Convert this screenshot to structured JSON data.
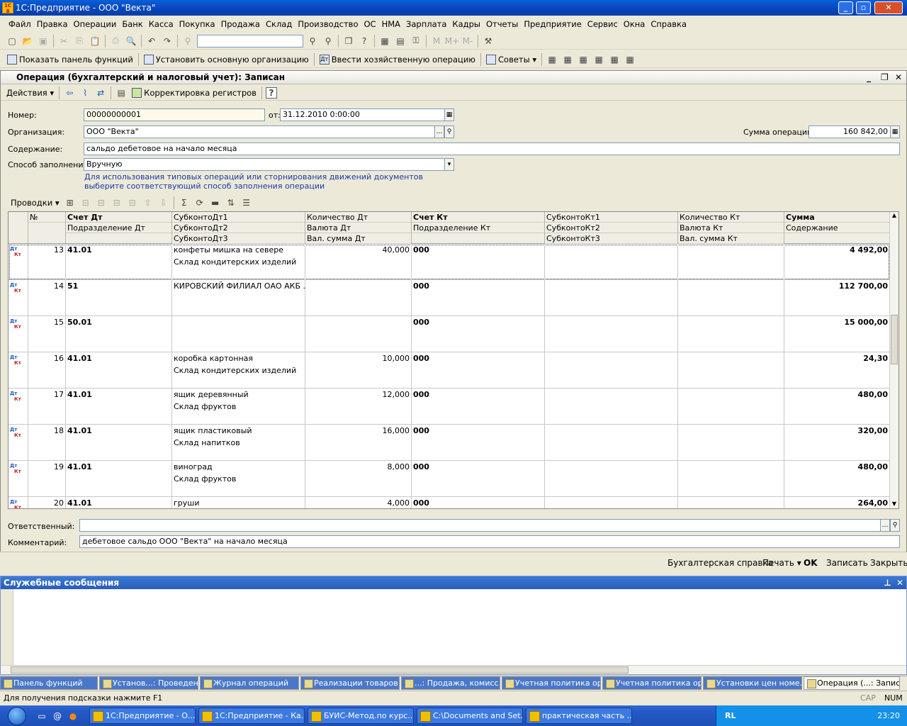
{
  "app_title": "1С:Предприятие - ООО \"Векта\"",
  "menu": [
    "Файл",
    "Правка",
    "Операции",
    "Банк",
    "Касса",
    "Покупка",
    "Продажа",
    "Склад",
    "Производство",
    "ОС",
    "НМА",
    "Зарплата",
    "Кадры",
    "Отчеты",
    "Предприятие",
    "Сервис",
    "Окна",
    "Справка"
  ],
  "toolbar2": {
    "show_panel": "Показать панель функций",
    "set_org": "Установить основную организацию",
    "enter_op": "Ввести хозяйственную операцию",
    "tips": "Советы"
  },
  "doc": {
    "title": "Операция (бухгалтерский и налоговый учет): Записан",
    "actions": "Действия",
    "correction": "Корректировка регистров",
    "number_label": "Номер:",
    "number": "00000000001",
    "date_label": "от:",
    "date": "31.12.2010  0:00:00",
    "org_label": "Организация:",
    "org": "ООО \"Векта\"",
    "sum_label": "Сумма операции:",
    "sum": "160 842,00",
    "content_label": "Содержание:",
    "content": "сальдо дебетовое на начало месяца",
    "fill_label": "Способ заполнения:",
    "fill": "Вручную",
    "hint1": "Для использования типовых операций или сторнирования движений документов",
    "hint2": "выберите соответствующий способ заполнения операции",
    "postings": "Проводки",
    "responsible_label": "Ответственный:",
    "responsible": "",
    "comment_label": "Комментарий:",
    "comment": "дебетовое сальдо ООО \"Векта\" на начало месяца"
  },
  "grid": {
    "headers": {
      "num": "№",
      "dt": [
        "Счет Дт",
        "Подразделение Дт"
      ],
      "subdt": [
        "СубконтоДт1",
        "СубконтоДт2",
        "СубконтоДт3"
      ],
      "qtydt": [
        "Количество Дт",
        "Валюта Дт",
        "Вал. сумма Дт"
      ],
      "kt": [
        "Счет Кт",
        "Подразделение Кт"
      ],
      "subkt": [
        "СубконтоКт1",
        "СубконтоКт2",
        "СубконтоКт3"
      ],
      "qtykt": [
        "Количество Кт",
        "Валюта Кт",
        "Вал. сумма Кт"
      ],
      "sum": [
        "Сумма",
        "Содержание"
      ]
    },
    "rows": [
      {
        "n": "13",
        "dt": "41.01",
        "s1": "конфеты мишка на севере",
        "s2": "Склад кондитерских изделий",
        "qty": "40,000",
        "kt": "000",
        "sum": "4 492,00"
      },
      {
        "n": "14",
        "dt": "51",
        "s1": "КИРОВСКИЙ ФИЛИАЛ ОАО АКБ ...",
        "s2": "",
        "qty": "",
        "kt": "000",
        "sum": "112 700,00"
      },
      {
        "n": "15",
        "dt": "50.01",
        "s1": "",
        "s2": "",
        "qty": "",
        "kt": "000",
        "sum": "15 000,00"
      },
      {
        "n": "16",
        "dt": "41.01",
        "s1": "коробка картонная",
        "s2": "Склад кондитерских изделий",
        "qty": "10,000",
        "kt": "000",
        "sum": "24,30"
      },
      {
        "n": "17",
        "dt": "41.01",
        "s1": "ящик деревянный",
        "s2": "Склад фруктов",
        "qty": "12,000",
        "kt": "000",
        "sum": "480,00"
      },
      {
        "n": "18",
        "dt": "41.01",
        "s1": "ящик пластиковый",
        "s2": "Склад напитков",
        "qty": "16,000",
        "kt": "000",
        "sum": "320,00"
      },
      {
        "n": "19",
        "dt": "41.01",
        "s1": "виноград",
        "s2": "Склад фруктов",
        "qty": "8,000",
        "kt": "000",
        "sum": "480,00"
      },
      {
        "n": "20",
        "dt": "41.01",
        "s1": "груши",
        "s2": "",
        "qty": "4,000",
        "kt": "000",
        "sum": "264,00"
      }
    ],
    "dt_mark": "Дт",
    "kt_mark": "Кт"
  },
  "bottom": {
    "ref": "Бухгалтерская справка",
    "print": "Печать",
    "ok": "OK",
    "save": "Записать",
    "close": "Закрыть"
  },
  "service": {
    "title": "Служебные сообщения"
  },
  "panels": [
    "Панель функций",
    "Установ...: Проведен *",
    "Журнал операций",
    "Реализации товаров ...",
    "...: Продажа, комисс...",
    "Учетная политика ор...",
    "Учетная политика ор...",
    "Установки цен номе...",
    "Операция (...: Записан"
  ],
  "status": {
    "text": "Для получения подсказки нажмите F1",
    "cap": "CAP",
    "num": "NUM"
  },
  "taskbar": {
    "tasks": [
      "1С:Предприятие - О...",
      "1С:Предприятие - Ка...",
      "БУИС-Метод.по курс...",
      "C:\\Documents and Set...",
      "практическая часть ..."
    ],
    "lang": "RL",
    "clock": "23:20"
  }
}
